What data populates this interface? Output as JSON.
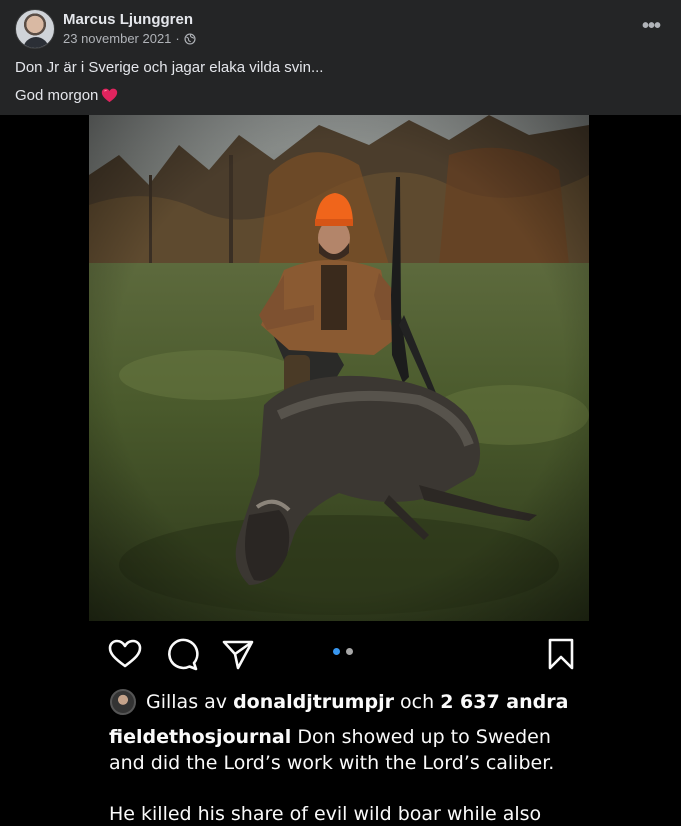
{
  "post": {
    "author": "Marcus Ljunggren",
    "date": "23 november 2021",
    "separator": "·",
    "privacy_icon": "globe-icon",
    "more_label": "•••",
    "text_line1": "Don Jr är i Sverige och jagar elaka vilda svin...",
    "text_line2": "God morgon"
  },
  "instagram": {
    "image": "man in orange cap kneeling with rifle behind a dead wild boar in a grassy field",
    "actions": [
      "heart-icon",
      "comment-icon",
      "share-icon",
      "bookmark-icon"
    ],
    "carousel": {
      "active_index": 0,
      "count": 2,
      "active_color": "#3897f0",
      "inactive_color": "#a8a8a8"
    },
    "likes": {
      "prefix": "Gillas av",
      "user": "donaldjtrumpjr",
      "conj": "och",
      "count": "2 637 andra"
    },
    "caption": {
      "username": "fieldethosjournal",
      "text": "Don showed up to Sweden and did the Lord’s work with the Lord’s caliber.",
      "text2": "He killed his share of evil wild boar while also"
    }
  },
  "colors": {
    "fb_bg": "#242526",
    "ig_bg": "#000000",
    "text": "#e4e6eb",
    "secondary": "#b0b3b8"
  }
}
